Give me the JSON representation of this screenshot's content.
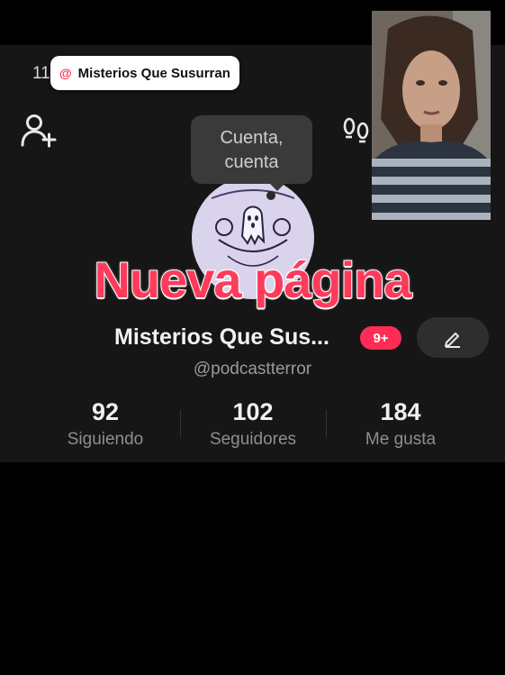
{
  "status_bar": {
    "time": "11",
    "right_glyph": "0"
  },
  "mention": {
    "at_symbol": "@",
    "text": "Misterios Que Susurran"
  },
  "tooltip": {
    "line1": "Cuenta,",
    "line2": "cuenta"
  },
  "overlay": {
    "headline": "Nueva página"
  },
  "profile": {
    "name": "Misterios Que Sus...",
    "badge": "9+",
    "username": "@podcastterror"
  },
  "stats": [
    {
      "value": "92",
      "label": "Siguiendo"
    },
    {
      "value": "102",
      "label": "Seguidores"
    },
    {
      "value": "184",
      "label": "Me gusta"
    }
  ],
  "icons": {
    "add_user": "add-user-icon",
    "footprint": "footprint-icon",
    "edit": "pencil-icon"
  },
  "colors": {
    "accent": "#ff2d55",
    "headline": "#ff3b5c",
    "background": "#161616"
  }
}
